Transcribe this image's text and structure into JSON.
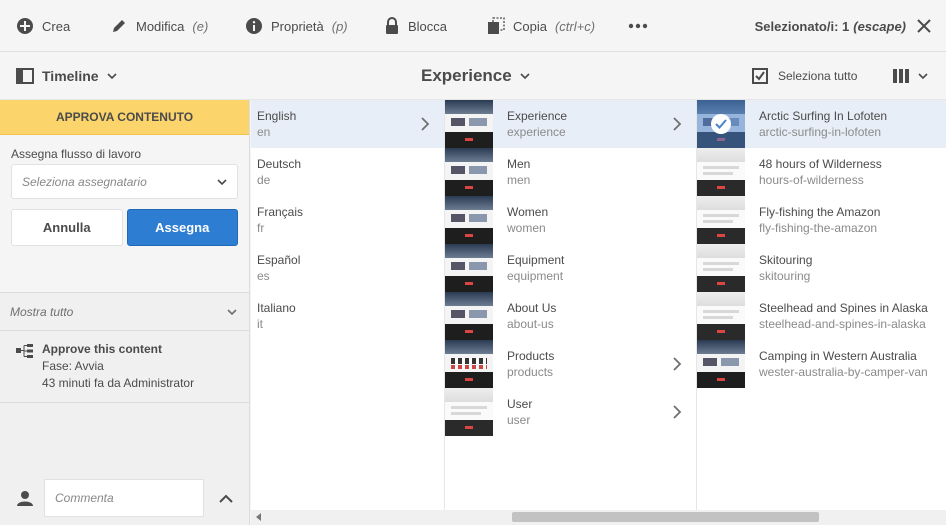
{
  "actionbar": {
    "create_label": "Crea",
    "edit_label": "Modifica",
    "edit_hint": "(e)",
    "properties_label": "Proprietà",
    "properties_hint": "(p)",
    "lock_label": "Blocca",
    "copy_label": "Copia",
    "copy_hint": "(ctrl+c)",
    "more_icon": "more-icon",
    "selection_label": "Selezionato/i: 1",
    "selection_hint": "(escape)"
  },
  "toolbar": {
    "rail_switch_label": "Timeline",
    "current_path": "Experience",
    "select_all_label": "Seleziona tutto"
  },
  "rail": {
    "banner": "APPROVA CONTENUTO",
    "workflow_label": "Assegna flusso di lavoro",
    "assignee_placeholder": "Seleziona assegnatario",
    "cancel_label": "Annulla",
    "assign_label": "Assegna",
    "show_all_label": "Mostra tutto",
    "timeline_item": {
      "title": "Approve this content",
      "phase": "Fase: Avvia",
      "meta": "43 minuti fa da Administrator"
    },
    "comment_placeholder": "Commenta"
  },
  "columns": {
    "languages": [
      {
        "title": "English",
        "name": "en",
        "active": true,
        "has_children": true
      },
      {
        "title": "Deutsch",
        "name": "de"
      },
      {
        "title": "Français",
        "name": "fr"
      },
      {
        "title": "Español",
        "name": "es"
      },
      {
        "title": "Italiano",
        "name": "it"
      }
    ],
    "sections": [
      {
        "title": "Experience",
        "name": "experience",
        "active": true,
        "has_children": true
      },
      {
        "title": "Men",
        "name": "men"
      },
      {
        "title": "Women",
        "name": "women"
      },
      {
        "title": "Equipment",
        "name": "equipment"
      },
      {
        "title": "About Us",
        "name": "about-us"
      },
      {
        "title": "Products",
        "name": "products",
        "has_children": true
      },
      {
        "title": "User",
        "name": "user",
        "has_children": true
      }
    ],
    "pages": [
      {
        "title": "Arctic Surfing In Lofoten",
        "name": "arctic-surfing-in-lofoten",
        "selected": true
      },
      {
        "title": "48 hours of Wilderness",
        "name": "hours-of-wilderness"
      },
      {
        "title": "Fly-fishing the Amazon",
        "name": "fly-fishing-the-amazon"
      },
      {
        "title": "Skitouring",
        "name": "skitouring"
      },
      {
        "title": "Steelhead and Spines in Alaska",
        "name": "steelhead-and-spines-in-alaska"
      },
      {
        "title": "Camping in Western Australia",
        "name": "wester-australia-by-camper-van"
      }
    ]
  },
  "colors": {
    "banner": "#fbd46b",
    "primary": "#2d7dd2",
    "active_row": "#e8eef7"
  }
}
